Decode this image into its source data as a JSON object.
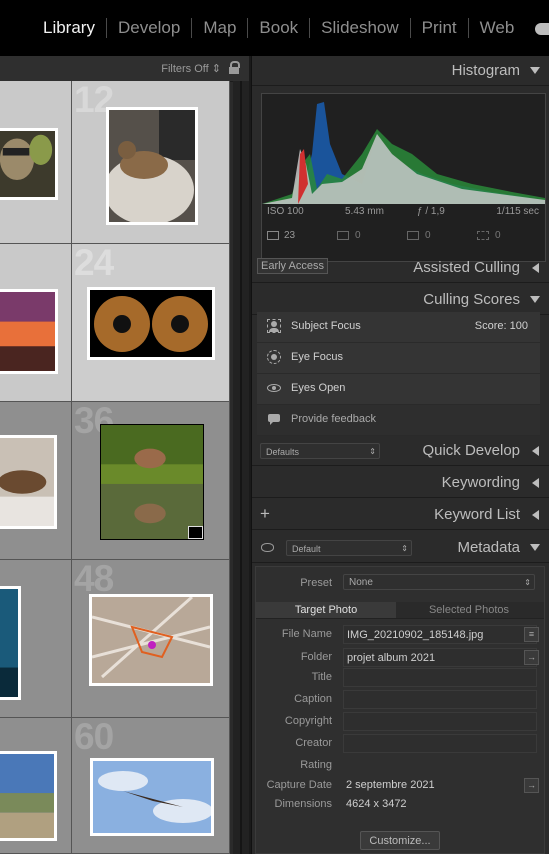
{
  "modules": [
    "Library",
    "Develop",
    "Map",
    "Book",
    "Slideshow",
    "Print",
    "Web"
  ],
  "grid": {
    "filters_label": "Filters Off",
    "cell_numbers": [
      "12",
      "24",
      "36",
      "48",
      "60"
    ]
  },
  "histogram": {
    "title": "Histogram",
    "iso": "ISO 100",
    "focal": "5.43 mm",
    "aperture": "ƒ / 1,9",
    "shutter": "1/115 sec",
    "count": "23",
    "z1": "0",
    "z2": "0",
    "z3": "0"
  },
  "assisted_culling": {
    "badge": "Early Access",
    "title": "Assisted Culling"
  },
  "culling_scores": {
    "title": "Culling Scores",
    "subject_focus": "Subject Focus",
    "score": "Score: 100",
    "eye_focus": "Eye Focus",
    "eyes_open": "Eyes Open",
    "feedback": "Provide feedback"
  },
  "quick_develop": {
    "preset": "Defaults",
    "title": "Quick Develop"
  },
  "keywording": {
    "title": "Keywording"
  },
  "keyword_list": {
    "plus": "+",
    "title": "Keyword List"
  },
  "metadata": {
    "preset_select": "Default",
    "title": "Metadata",
    "preset_label": "Preset",
    "preset_value": "None",
    "tab_target": "Target Photo",
    "tab_selected": "Selected Photos",
    "fields": [
      {
        "k": "File Name",
        "v": "IMG_20210902_185148.jpg"
      },
      {
        "k": "Folder",
        "v": "projet album 2021"
      },
      {
        "k": "Title",
        "v": ""
      },
      {
        "k": "Caption",
        "v": ""
      },
      {
        "k": "Copyright",
        "v": ""
      },
      {
        "k": "Creator",
        "v": ""
      },
      {
        "k": "Rating",
        "v": ""
      },
      {
        "k": "Capture Date",
        "v": "2 septembre 2021"
      },
      {
        "k": "Dimensions",
        "v": "4624 x 3472"
      }
    ],
    "customize": "Customize..."
  }
}
